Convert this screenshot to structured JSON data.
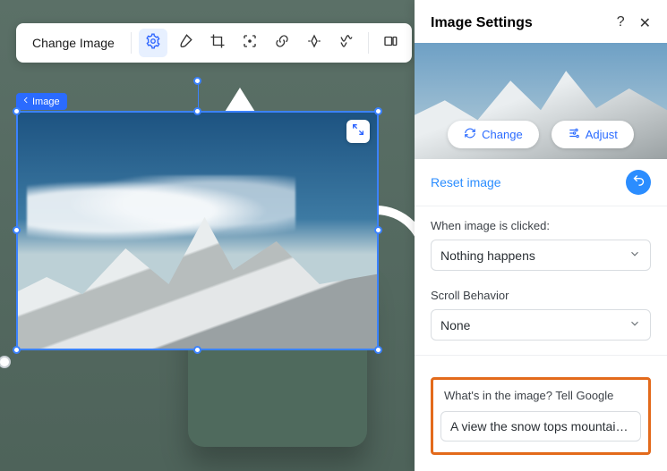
{
  "toolbar": {
    "change_image_label": "Change Image",
    "icons": {
      "design": "design-icon",
      "brush": "brush-icon",
      "crop": "crop-icon",
      "focal": "focal-point-icon",
      "link": "link-icon",
      "animate": "animation-icon",
      "mask": "mask-icon",
      "stretch": "stretch-icon"
    }
  },
  "breadcrumb": {
    "label": "Image"
  },
  "panel": {
    "title": "Image Settings",
    "change_btn": "Change",
    "adjust_btn": "Adjust",
    "reset_label": "Reset image",
    "click_label": "When image is clicked:",
    "click_value": "Nothing happens",
    "scroll_label": "Scroll Behavior",
    "scroll_value": "None",
    "alt_label": "What's in the image? Tell Google",
    "alt_value": "A view the snow tops mountais, ever…"
  }
}
